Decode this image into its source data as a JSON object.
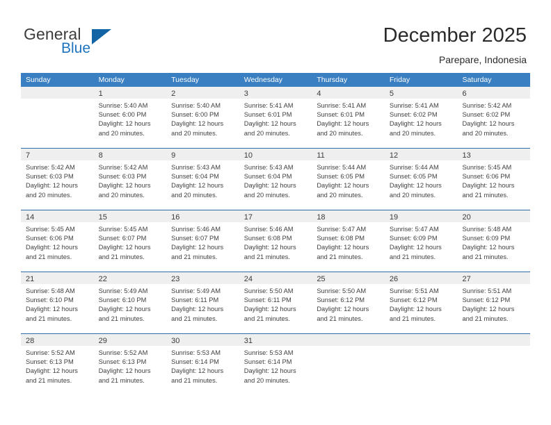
{
  "brand": {
    "name_top": "General",
    "name_bottom": "Blue",
    "triangle_color": "#1364a5",
    "blue_color": "#1e73be"
  },
  "header": {
    "title": "December 2025",
    "subtitle": "Parepare, Indonesia"
  },
  "theme": {
    "header_row_bg": "#3a7fc1",
    "week_separator": "#2d6ca8",
    "daynum_band_bg": "#efefef",
    "text": "#404040"
  },
  "weekday_headers": [
    "Sunday",
    "Monday",
    "Tuesday",
    "Wednesday",
    "Thursday",
    "Friday",
    "Saturday"
  ],
  "weeks": [
    [
      {
        "day": "",
        "lines": []
      },
      {
        "day": "1",
        "lines": [
          "Sunrise: 5:40 AM",
          "Sunset: 6:00 PM",
          "Daylight: 12 hours",
          "and 20 minutes."
        ]
      },
      {
        "day": "2",
        "lines": [
          "Sunrise: 5:40 AM",
          "Sunset: 6:00 PM",
          "Daylight: 12 hours",
          "and 20 minutes."
        ]
      },
      {
        "day": "3",
        "lines": [
          "Sunrise: 5:41 AM",
          "Sunset: 6:01 PM",
          "Daylight: 12 hours",
          "and 20 minutes."
        ]
      },
      {
        "day": "4",
        "lines": [
          "Sunrise: 5:41 AM",
          "Sunset: 6:01 PM",
          "Daylight: 12 hours",
          "and 20 minutes."
        ]
      },
      {
        "day": "5",
        "lines": [
          "Sunrise: 5:41 AM",
          "Sunset: 6:02 PM",
          "Daylight: 12 hours",
          "and 20 minutes."
        ]
      },
      {
        "day": "6",
        "lines": [
          "Sunrise: 5:42 AM",
          "Sunset: 6:02 PM",
          "Daylight: 12 hours",
          "and 20 minutes."
        ]
      }
    ],
    [
      {
        "day": "7",
        "lines": [
          "Sunrise: 5:42 AM",
          "Sunset: 6:03 PM",
          "Daylight: 12 hours",
          "and 20 minutes."
        ]
      },
      {
        "day": "8",
        "lines": [
          "Sunrise: 5:42 AM",
          "Sunset: 6:03 PM",
          "Daylight: 12 hours",
          "and 20 minutes."
        ]
      },
      {
        "day": "9",
        "lines": [
          "Sunrise: 5:43 AM",
          "Sunset: 6:04 PM",
          "Daylight: 12 hours",
          "and 20 minutes."
        ]
      },
      {
        "day": "10",
        "lines": [
          "Sunrise: 5:43 AM",
          "Sunset: 6:04 PM",
          "Daylight: 12 hours",
          "and 20 minutes."
        ]
      },
      {
        "day": "11",
        "lines": [
          "Sunrise: 5:44 AM",
          "Sunset: 6:05 PM",
          "Daylight: 12 hours",
          "and 20 minutes."
        ]
      },
      {
        "day": "12",
        "lines": [
          "Sunrise: 5:44 AM",
          "Sunset: 6:05 PM",
          "Daylight: 12 hours",
          "and 20 minutes."
        ]
      },
      {
        "day": "13",
        "lines": [
          "Sunrise: 5:45 AM",
          "Sunset: 6:06 PM",
          "Daylight: 12 hours",
          "and 21 minutes."
        ]
      }
    ],
    [
      {
        "day": "14",
        "lines": [
          "Sunrise: 5:45 AM",
          "Sunset: 6:06 PM",
          "Daylight: 12 hours",
          "and 21 minutes."
        ]
      },
      {
        "day": "15",
        "lines": [
          "Sunrise: 5:45 AM",
          "Sunset: 6:07 PM",
          "Daylight: 12 hours",
          "and 21 minutes."
        ]
      },
      {
        "day": "16",
        "lines": [
          "Sunrise: 5:46 AM",
          "Sunset: 6:07 PM",
          "Daylight: 12 hours",
          "and 21 minutes."
        ]
      },
      {
        "day": "17",
        "lines": [
          "Sunrise: 5:46 AM",
          "Sunset: 6:08 PM",
          "Daylight: 12 hours",
          "and 21 minutes."
        ]
      },
      {
        "day": "18",
        "lines": [
          "Sunrise: 5:47 AM",
          "Sunset: 6:08 PM",
          "Daylight: 12 hours",
          "and 21 minutes."
        ]
      },
      {
        "day": "19",
        "lines": [
          "Sunrise: 5:47 AM",
          "Sunset: 6:09 PM",
          "Daylight: 12 hours",
          "and 21 minutes."
        ]
      },
      {
        "day": "20",
        "lines": [
          "Sunrise: 5:48 AM",
          "Sunset: 6:09 PM",
          "Daylight: 12 hours",
          "and 21 minutes."
        ]
      }
    ],
    [
      {
        "day": "21",
        "lines": [
          "Sunrise: 5:48 AM",
          "Sunset: 6:10 PM",
          "Daylight: 12 hours",
          "and 21 minutes."
        ]
      },
      {
        "day": "22",
        "lines": [
          "Sunrise: 5:49 AM",
          "Sunset: 6:10 PM",
          "Daylight: 12 hours",
          "and 21 minutes."
        ]
      },
      {
        "day": "23",
        "lines": [
          "Sunrise: 5:49 AM",
          "Sunset: 6:11 PM",
          "Daylight: 12 hours",
          "and 21 minutes."
        ]
      },
      {
        "day": "24",
        "lines": [
          "Sunrise: 5:50 AM",
          "Sunset: 6:11 PM",
          "Daylight: 12 hours",
          "and 21 minutes."
        ]
      },
      {
        "day": "25",
        "lines": [
          "Sunrise: 5:50 AM",
          "Sunset: 6:12 PM",
          "Daylight: 12 hours",
          "and 21 minutes."
        ]
      },
      {
        "day": "26",
        "lines": [
          "Sunrise: 5:51 AM",
          "Sunset: 6:12 PM",
          "Daylight: 12 hours",
          "and 21 minutes."
        ]
      },
      {
        "day": "27",
        "lines": [
          "Sunrise: 5:51 AM",
          "Sunset: 6:12 PM",
          "Daylight: 12 hours",
          "and 21 minutes."
        ]
      }
    ],
    [
      {
        "day": "28",
        "lines": [
          "Sunrise: 5:52 AM",
          "Sunset: 6:13 PM",
          "Daylight: 12 hours",
          "and 21 minutes."
        ]
      },
      {
        "day": "29",
        "lines": [
          "Sunrise: 5:52 AM",
          "Sunset: 6:13 PM",
          "Daylight: 12 hours",
          "and 21 minutes."
        ]
      },
      {
        "day": "30",
        "lines": [
          "Sunrise: 5:53 AM",
          "Sunset: 6:14 PM",
          "Daylight: 12 hours",
          "and 21 minutes."
        ]
      },
      {
        "day": "31",
        "lines": [
          "Sunrise: 5:53 AM",
          "Sunset: 6:14 PM",
          "Daylight: 12 hours",
          "and 20 minutes."
        ]
      },
      {
        "day": "",
        "lines": []
      },
      {
        "day": "",
        "lines": []
      },
      {
        "day": "",
        "lines": []
      }
    ]
  ]
}
